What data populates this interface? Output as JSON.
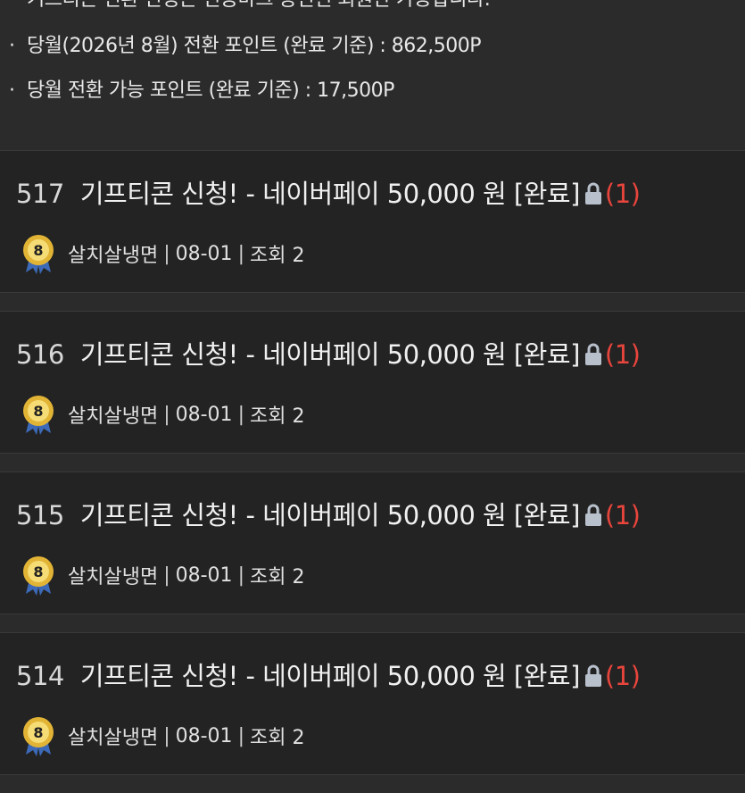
{
  "notice": {
    "bullet": "·",
    "lines": [
      "기프티콘 전환 신청은 인증마크 승인된 회원만 가능합니다.",
      "당월(2026년 8월) 전환 포인트 (완료 기준) : 862,500P",
      "당월 전환 가능 포인트 (완료 기준) : 17,500P"
    ]
  },
  "posts": [
    {
      "num": "517",
      "title": "기프티콘 신청! - 네이버페이 50,000 원 [완료]",
      "comments": "(1)",
      "author": "살치살냉면",
      "date": "08-01",
      "views": "조회 2",
      "level": "8"
    },
    {
      "num": "516",
      "title": "기프티콘 신청! - 네이버페이 50,000 원 [완료]",
      "comments": "(1)",
      "author": "살치살냉면",
      "date": "08-01",
      "views": "조회 2",
      "level": "8"
    },
    {
      "num": "515",
      "title": "기프티콘 신청! - 네이버페이 50,000 원 [완료]",
      "comments": "(1)",
      "author": "살치살냉면",
      "date": "08-01",
      "views": "조회 2",
      "level": "8"
    },
    {
      "num": "514",
      "title": "기프티콘 신청! - 네이버페이 50,000 원 [완료]",
      "comments": "(1)",
      "author": "살치살냉면",
      "date": "08-01",
      "views": "조회 2",
      "level": "8"
    }
  ],
  "separator": "|",
  "icons": {
    "lock": "lock-icon",
    "badge": "level-badge-icon"
  },
  "colors": {
    "background": "#2b2b2b",
    "card": "#232323",
    "comment": "#e8453c",
    "lock": "#b8c0cc",
    "badge": "#e2b436"
  }
}
